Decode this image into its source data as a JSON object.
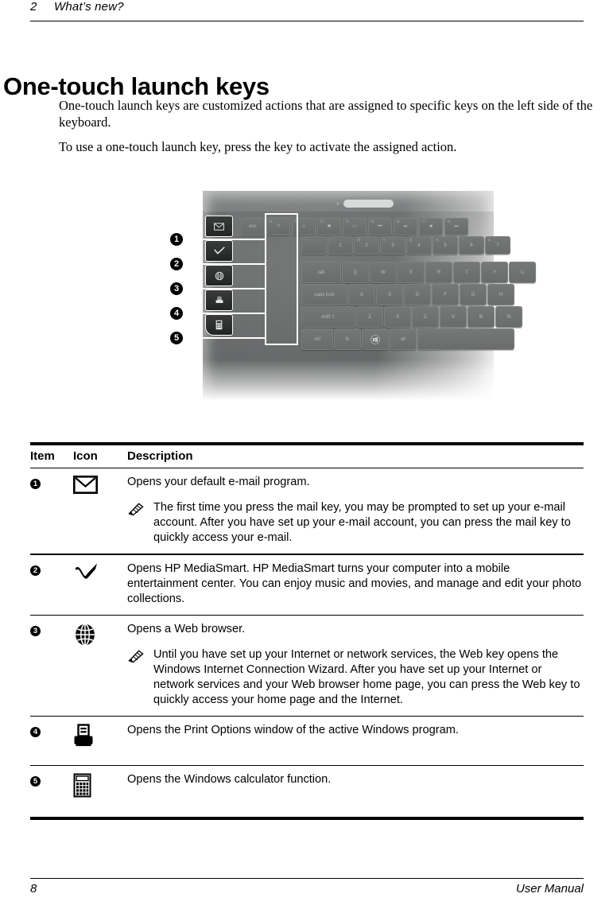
{
  "header": {
    "chapter_number": "2",
    "chapter_title": "What’s new?"
  },
  "heading": "One-touch launch keys",
  "paragraphs": [
    "One-touch launch keys are customized actions that are assigned to specific keys on the left side of the keyboard.",
    "To use a one-touch launch key, press the key to activate the assigned action."
  ],
  "figure": {
    "name": "keyboard-with-launch-keys",
    "callouts": [
      "1",
      "2",
      "3",
      "4",
      "5"
    ],
    "launch_key_icons": [
      "mail-icon",
      "checkmark-icon",
      "globe-icon",
      "printer-icon",
      "calculator-icon"
    ],
    "function_row_keys": [
      {
        "label": "esc",
        "sup": ""
      },
      {
        "label": "?",
        "sup": "f1"
      },
      {
        "label": "☀",
        "sup": "f2"
      },
      {
        "label": "✱",
        "sup": "f3"
      },
      {
        "label": "▭",
        "sup": "f4"
      },
      {
        "label": "⏮",
        "sup": "f5"
      },
      {
        "label": "⏯",
        "sup": "f6"
      },
      {
        "label": "■",
        "sup": "f7"
      },
      {
        "label": "⏭",
        "sup": "f8"
      }
    ],
    "number_row_keys": [
      {
        "label": "`",
        "sup": "~"
      },
      {
        "label": "1",
        "sup": "!"
      },
      {
        "label": "2",
        "sup": "@"
      },
      {
        "label": "3",
        "sup": "#"
      },
      {
        "label": "4",
        "sup": "$"
      },
      {
        "label": "5",
        "sup": "%"
      },
      {
        "label": "6",
        "sup": "^"
      },
      {
        "label": "7",
        "sup": "&"
      }
    ],
    "row_q": [
      "tab",
      "Q",
      "W",
      "E",
      "R",
      "T",
      "Y",
      "U"
    ],
    "row_a": [
      "caps lock",
      "A",
      "S",
      "D",
      "F",
      "G",
      "H"
    ],
    "row_z": [
      "shift",
      "Z",
      "X",
      "C",
      "V",
      "B",
      "N"
    ],
    "row_bottom": [
      "ctrl",
      "fn",
      "windows-icon",
      "alt",
      "space"
    ],
    "colors": {
      "body": "#6e7071",
      "key": "#717373",
      "launch_key": "#2a2c2c",
      "callout": "#000000"
    }
  },
  "table": {
    "columns": [
      "Item",
      "Icon",
      "Description"
    ],
    "rows": [
      {
        "item": "1",
        "icon": "mail-icon",
        "description": "Opens your default e-mail program.",
        "note": "The first time you press the mail key, you may be prompted to set up your e-mail account. After you have set up your e-mail account, you can press the mail key to quickly access your e-mail."
      },
      {
        "item": "2",
        "icon": "checkmark-icon",
        "description": "Opens HP MediaSmart. HP MediaSmart turns your computer into a mobile entertainment center. You can enjoy music and movies, and manage and edit your photo collections.",
        "note": ""
      },
      {
        "item": "3",
        "icon": "globe-icon",
        "description": "Opens a Web browser.",
        "note": "Until you have set up your Internet or network services, the Web key opens the Windows Internet Connection Wizard. After you have set up your Internet or network services and your Web browser home page, you can press the Web key to quickly access your home page and the Internet."
      },
      {
        "item": "4",
        "icon": "printer-icon",
        "description": "Opens the Print Options window of the active Windows program.",
        "note": ""
      },
      {
        "item": "5",
        "icon": "calculator-icon",
        "description": "Opens the Windows calculator function.",
        "note": ""
      }
    ]
  },
  "footer": {
    "page_number": "8",
    "document_title": "User Manual"
  }
}
